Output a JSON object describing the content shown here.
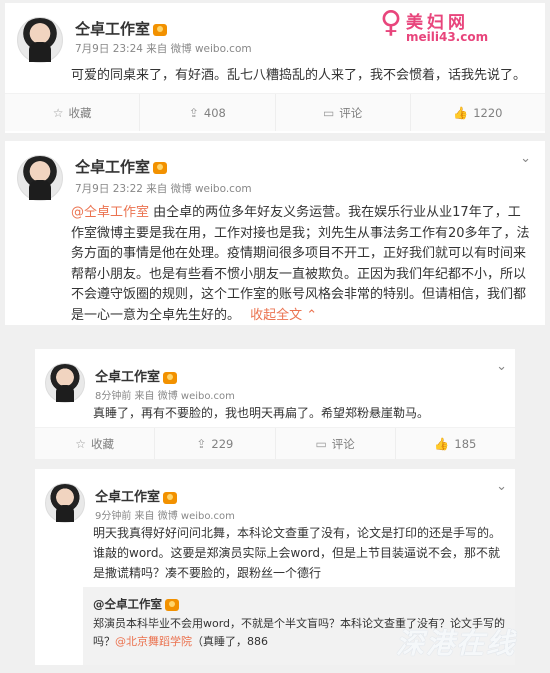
{
  "posts": [
    {
      "name": "仝卓工作室",
      "meta": "7月9日 23:24 来自 微博 weibo.com",
      "text": "可爱的同桌来了，有好酒。乱七八糟捣乱的人来了，我不会惯着，话我先说了。",
      "actions": {
        "fav": "收藏",
        "repost": "408",
        "comment": "评论",
        "like": "1220"
      }
    },
    {
      "name": "仝卓工作室",
      "meta": "7月9日 23:22 来自 微博 weibo.com",
      "mention": "@仝卓工作室",
      "text": " 由仝卓的两位多年好友义务运营。我在娱乐行业从业17年了，工作室微博主要是我在用，工作对接也是我；刘先生从事法务工作有20多年了，法务方面的事情是他在处理。疫情期间很多项目不开工，正好我们就可以有时间来帮帮小朋友。也是有些看不惯小朋友一直被欺负。正因为我们年纪都不小，所以不会遵守饭圈的规则，这个工作室的账号风格会非常的特别。但请相信，我们都是一心一意为仝卓先生好的。",
      "collapse": "收起全文"
    },
    {
      "name": "仝卓工作室",
      "meta": "8分钟前 来自 微博 weibo.com",
      "text": "真睡了，再有不要脸的，我也明天再扁了。希望郑粉悬崖勒马。",
      "actions": {
        "fav": "收藏",
        "repost": "229",
        "comment": "评论",
        "like": "185"
      }
    },
    {
      "name": "仝卓工作室",
      "meta": "9分钟前 来自 微博 weibo.com",
      "text": "明天我真得好好问问北舞，本科论文查重了没有，论文是打印的还是手写的。谁敲的word。这要是郑演员实际上会word，但是上节目装逼说不会，那不就是撒谎精吗？凑不要脸的，跟粉丝一个德行",
      "quote_name": "@仝卓工作室",
      "quote_text": "郑演员本科毕业不会用word，不就是个半文盲吗？本科论文查重了没有？论文手写的吗？",
      "quote_mention": "@北京舞蹈学院",
      "quote_tail": "（真睡了，886"
    }
  ],
  "watermark_top": {
    "line1": "美妇网",
    "line2": "meili43.com"
  },
  "watermark_bottom": "深港在线"
}
